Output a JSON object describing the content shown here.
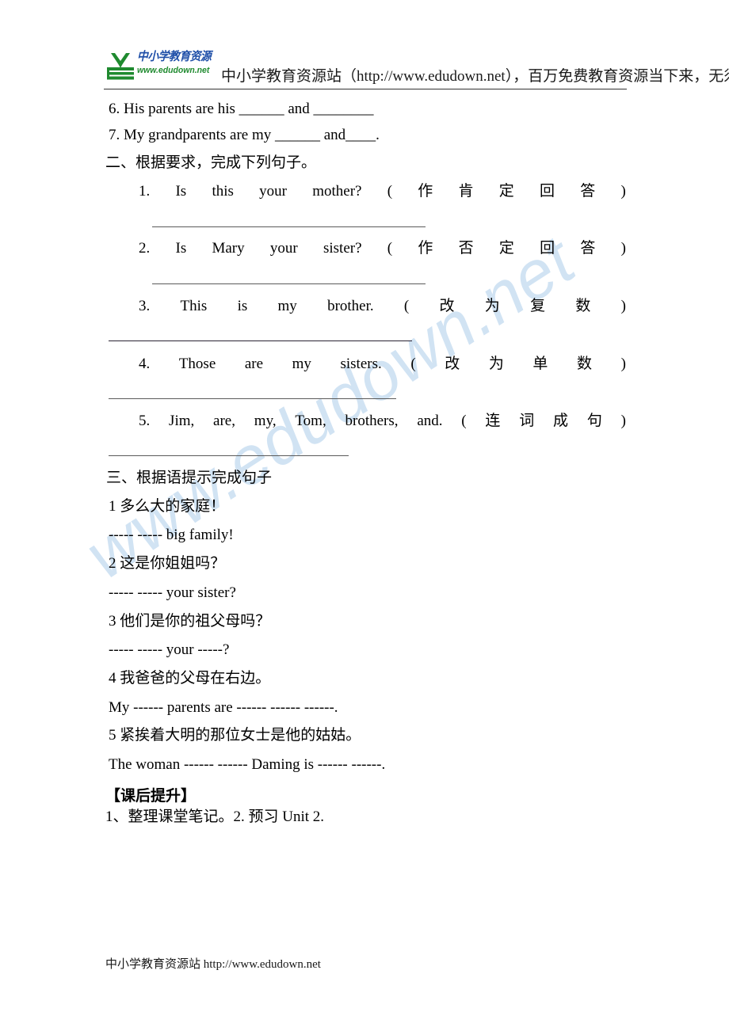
{
  "header": {
    "logo": {
      "cn_text": "中小学教育资源",
      "url_text": "www.edudown.net",
      "mark_name": "sprout-books-logo-icon"
    },
    "banner_text": "中小学教育资源站（http://www.edudown.net），百万免费教育资源当下来，无须注册！"
  },
  "watermark": {
    "text": "www.edudown.net"
  },
  "section_one_tail": {
    "item6": "6. His parents are his ______ and ________",
    "item7": "7. My grandparents are my ______ and____."
  },
  "section_two": {
    "heading": "二、根据要求，完成下列句子。",
    "items": [
      {
        "number": "1.",
        "words": [
          "Is",
          "this",
          "your",
          "mother?"
        ],
        "paren_open": "(",
        "instruction": [
          "作",
          "肯",
          "定",
          "回",
          "答"
        ],
        "paren_close": ")"
      },
      {
        "number": "2.",
        "words": [
          "Is",
          "Mary",
          "your",
          "sister?"
        ],
        "paren_open": "(",
        "instruction": [
          "作",
          "否",
          "定",
          "回",
          "答"
        ],
        "paren_close": ")"
      },
      {
        "number": "3.",
        "words": [
          "This",
          "is",
          "my",
          "brother."
        ],
        "paren_open": "(",
        "instruction": [
          "改",
          "为",
          "复",
          "数"
        ],
        "paren_close": ")"
      },
      {
        "number": "4.",
        "words": [
          "Those",
          "are",
          "my",
          "sisters."
        ],
        "paren_open": "(",
        "instruction": [
          "改",
          "为",
          "单",
          "数"
        ],
        "paren_close": ")"
      },
      {
        "number": "5.",
        "words": [
          "Jim,",
          "are,",
          "my,",
          "Tom,",
          "brothers,",
          "and."
        ],
        "paren_open": "(",
        "instruction": [
          "连",
          "词",
          "成",
          "句"
        ],
        "paren_close": ")"
      }
    ]
  },
  "section_three": {
    "heading": "三、根据语提示完成句子",
    "items": [
      {
        "prompt": "1 多么大的家庭！",
        "answer": "----- ----- big family!"
      },
      {
        "prompt": "2 这是你姐姐吗？",
        "answer": "----- ----- your sister?"
      },
      {
        "prompt": "3 他们是你的祖父母吗？",
        "answer": "----- ----- your -----?"
      },
      {
        "prompt": "4 我爸爸的父母在右边。",
        "answer": "My ------ parents are ------ ------ ------."
      },
      {
        "prompt": "5 紧挨着大明的那位女士是他的姑姑。",
        "answer": "The woman ------ ------ Daming is ------ ------."
      }
    ]
  },
  "section_four": {
    "heading": "【课后提升】",
    "body": "1、整理课堂笔记。2. 预习 Unit 2."
  },
  "footer": {
    "text": "中小学教育资源站 http://www.edudown.net"
  },
  "colors": {
    "logo_blue": "#1f4fa8",
    "logo_green": "#1f8a2f",
    "watermark_blue": "#cfe2f3",
    "rule_gray": "#5a5a5a"
  }
}
